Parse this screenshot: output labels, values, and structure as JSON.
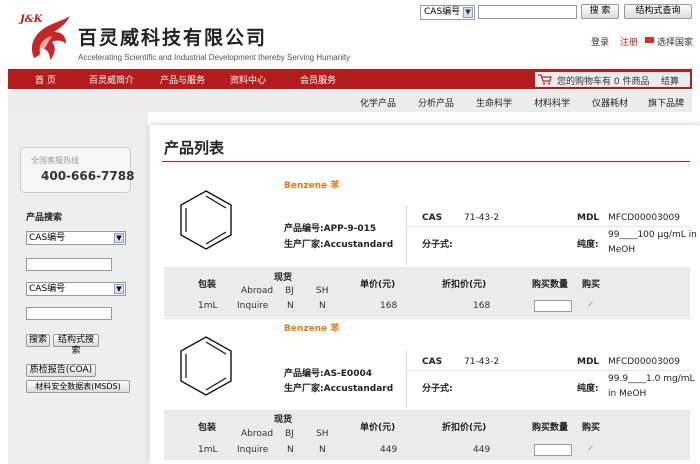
{
  "header": {
    "search_select": "CAS编号",
    "search_button": "搜 索",
    "structure_button": "结构式查询",
    "brand_logo_text": "J&K",
    "brand_name": "百灵威科技有限公司",
    "slogan": "Accelerating Scientific and Industrial Development thereby Serving Humanity",
    "login": "登录",
    "register": "注册",
    "country": "选择国家"
  },
  "nav": {
    "items": [
      "首 页",
      "百灵威简介",
      "产品与服务",
      "资料中心",
      "会员服务"
    ],
    "cart_text": "您的购物车有 0 件商品",
    "checkout": "结算"
  },
  "subnav": {
    "items": [
      "化学产品",
      "分析产品",
      "生命科学",
      "材料科学",
      "仪器耗材",
      "旗下品牌"
    ]
  },
  "sidebar": {
    "hotline_label": "全国客服热线",
    "hotline_number": "400-666-7788",
    "search_title": "产品搜索",
    "select1": "CAS编号",
    "select2": "CAS编号",
    "search_button": "搜索",
    "structure_button": "结构式搜索",
    "coa_button": "质检报告(COA)",
    "msds_button": "材料安全数据表(MSDS)"
  },
  "main": {
    "title": "产品列表",
    "table_headers": {
      "pack": "包装",
      "price_group": "现货",
      "abroad": "Abroad",
      "bj": "BJ",
      "sh": "SH",
      "price": "单价(元)",
      "discount": "折扣价(元)",
      "qty": "购买数量",
      "buy": "购买"
    },
    "products": [
      {
        "name": "Benzene  苯",
        "code": "产品编号:APP-9-015",
        "maker": "生产厂家:Accustandard",
        "cas_label": "CAS",
        "cas": "71-43-2",
        "mdl_label": "MDL",
        "mdl": "MFCD00003009",
        "formula_label": "分子式:",
        "purity_label": "纯度:",
        "purity_1": "99____100 μg/mL in",
        "purity_2": "MeOH",
        "row": {
          "pack": "1mL",
          "abroad": "Inquire",
          "bj": "N",
          "sh": "N",
          "price": "168",
          "discount": "168",
          "check": "✓"
        }
      },
      {
        "name": "Benzene  苯",
        "code": "产品编号:AS-E0004",
        "maker": "生产厂家:Accustandard",
        "cas_label": "CAS",
        "cas": "71-43-2",
        "mdl_label": "MDL",
        "mdl": "MFCD00003009",
        "formula_label": "分子式:",
        "purity_label": "纯度:",
        "purity_1": "99.9____1.0 mg/mL",
        "purity_2": "in MeOH",
        "row": {
          "pack": "1mL",
          "abroad": "Inquire",
          "bj": "N",
          "sh": "N",
          "price": "449",
          "discount": "449",
          "check": "✓"
        }
      }
    ]
  },
  "colors": {
    "brand_red": "#b51d1d",
    "accent_orange": "#e07a1a"
  }
}
